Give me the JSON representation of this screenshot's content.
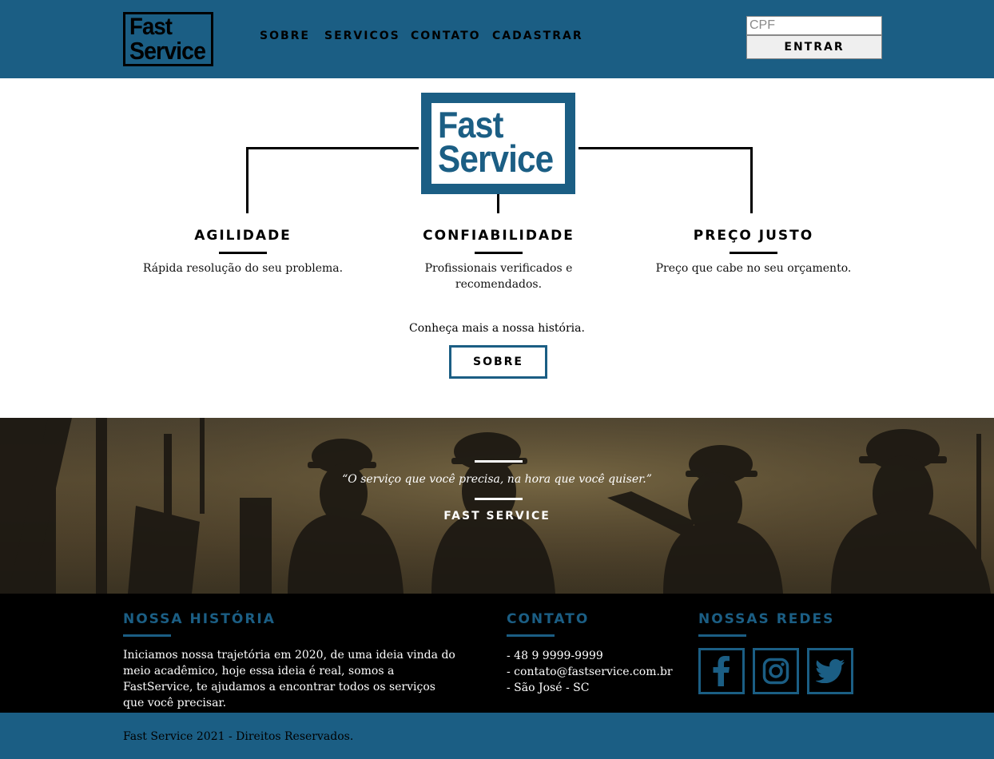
{
  "brand": {
    "line1": "Fast",
    "line2": "Service"
  },
  "colors": {
    "primary": "#1b5e84",
    "footer_bg": "#000000",
    "text_light": "#ffffff"
  },
  "nav": {
    "items": [
      {
        "label": "SOBRE"
      },
      {
        "label": "SERVICOS"
      },
      {
        "label": "CONTATO"
      },
      {
        "label": "CADASTRAR"
      }
    ]
  },
  "login": {
    "cpf_placeholder": "CPF",
    "button_label": "ENTRAR"
  },
  "features": [
    {
      "title": "AGILIDADE",
      "description": "Rápida resolução do seu problema."
    },
    {
      "title": "CONFIABILIDADE",
      "description": "Profissionais verificados e recomendados."
    },
    {
      "title": "PREÇO JUSTO",
      "description": "Preço que cabe no seu orçamento."
    }
  ],
  "about_cta": {
    "text": "Conheça mais a nossa história.",
    "button_label": "SOBRE"
  },
  "hero": {
    "quote": "“O serviço que você precisa, na hora que você quiser.”",
    "author": "FAST SERVICE"
  },
  "footer": {
    "history": {
      "title": "NOSSA HISTÓRIA",
      "text": "Iniciamos nossa trajetória em 2020, de uma ideia vinda do meio acadêmico, hoje essa ideia é real, somos a FastService, te ajudamos a encontrar todos os serviços que você precisar."
    },
    "contact": {
      "title": "CONTATO",
      "items": [
        "- 48 9 9999-9999",
        "- contato@fastservice.com.br",
        "- São José - SC"
      ]
    },
    "socials": {
      "title": "NOSSAS REDES",
      "icons": [
        "facebook-icon",
        "instagram-icon",
        "twitter-icon"
      ]
    }
  },
  "copyright": "Fast Service 2021 - Direitos Reservados."
}
